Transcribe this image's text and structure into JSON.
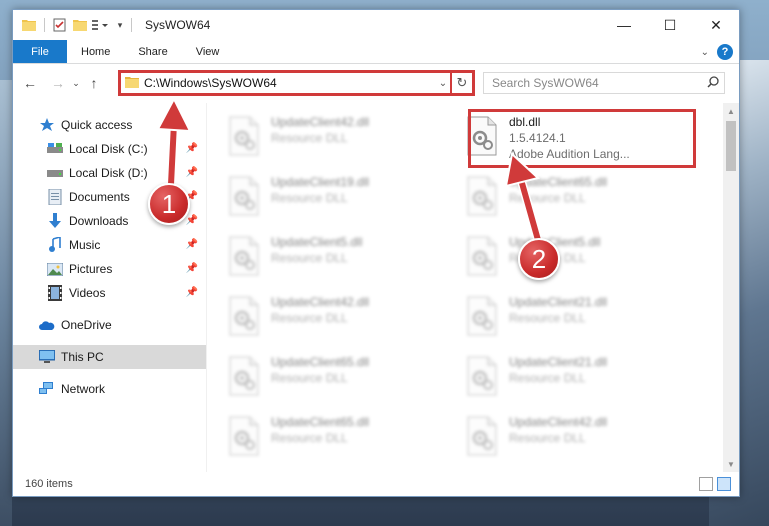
{
  "window": {
    "title": "SysWOW64",
    "controls": {
      "minimize": "—",
      "maximize": "☐",
      "close": "✕"
    }
  },
  "ribbon": {
    "file_tab": "File",
    "tabs": [
      "Home",
      "Share",
      "View"
    ]
  },
  "navigation": {
    "address_path": "C:\\Windows\\SysWOW64",
    "search_placeholder": "Search SysWOW64"
  },
  "sidebar": {
    "quick_access": "Quick access",
    "quick_items": [
      {
        "label": "Local Disk (C:)",
        "icon": "drive-icon"
      },
      {
        "label": "Local Disk (D:)",
        "icon": "drive-icon"
      },
      {
        "label": "Documents",
        "icon": "documents-icon"
      },
      {
        "label": "Downloads",
        "icon": "downloads-icon"
      },
      {
        "label": "Music",
        "icon": "music-icon"
      },
      {
        "label": "Pictures",
        "icon": "pictures-icon"
      },
      {
        "label": "Videos",
        "icon": "videos-icon"
      }
    ],
    "onedrive": "OneDrive",
    "this_pc": "This PC",
    "network": "Network"
  },
  "files": {
    "highlighted": {
      "name": "dbl.dll",
      "version": "1.5.4124.1",
      "description": "Adobe Audition Lang..."
    },
    "left_column": [
      {
        "name": "UpdateClient42.dll",
        "type": "Resource DLL"
      },
      {
        "name": "UpdateClient19.dll",
        "type": "Resource DLL"
      },
      {
        "name": "UpdateClient5.dll",
        "type": "Resource DLL"
      },
      {
        "name": "UpdateClient42.dll",
        "type": "Resource DLL"
      },
      {
        "name": "UpdateClient65.dll",
        "type": "Resource DLL"
      },
      {
        "name": "UpdateClient65.dll",
        "type": "Resource DLL"
      }
    ],
    "right_column": [
      {
        "name": "UpdateClient65.dll",
        "type": "Resource DLL"
      },
      {
        "name": "UpdateClient5.dll",
        "type": "Resource DLL"
      },
      {
        "name": "UpdateClient21.dll",
        "type": "Resource DLL"
      },
      {
        "name": "UpdateClient21.dll",
        "type": "Resource DLL"
      },
      {
        "name": "UpdateClient42.dll",
        "type": "Resource DLL"
      }
    ]
  },
  "status": {
    "item_count": "160 items"
  },
  "annotations": {
    "step1": "1",
    "step2": "2",
    "color": "#d03a3a"
  }
}
